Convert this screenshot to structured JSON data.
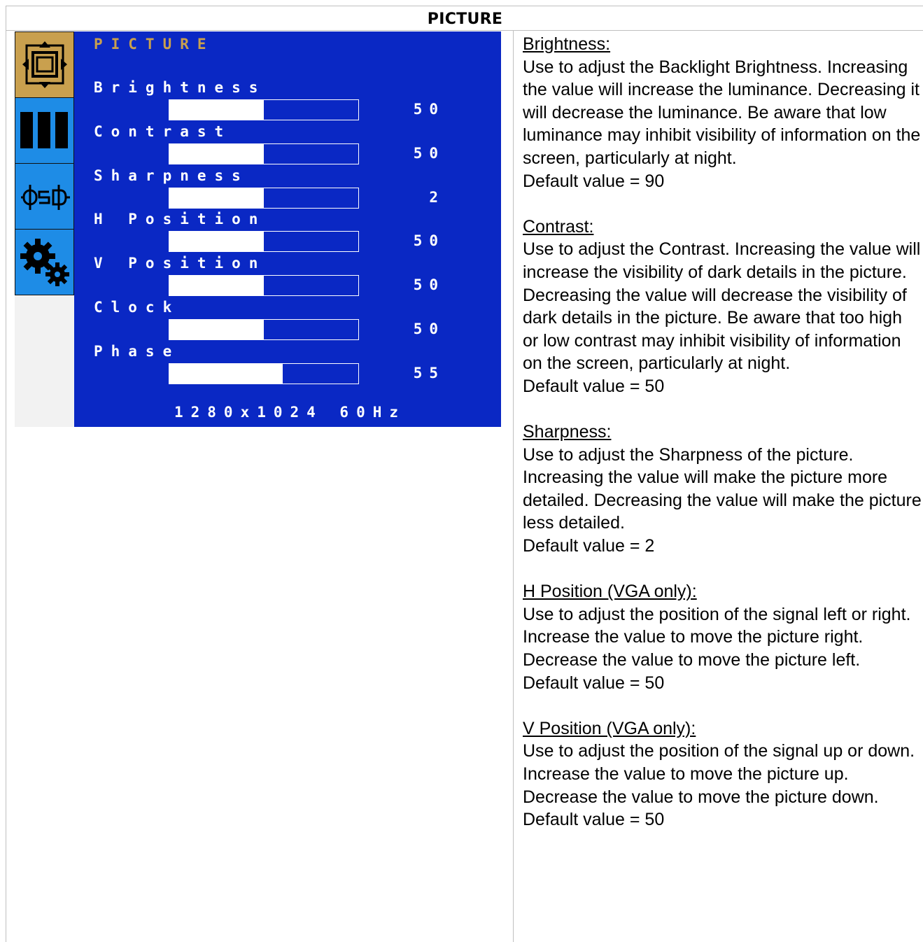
{
  "header": {
    "title": "PICTURE"
  },
  "osd": {
    "title": "PICTURE",
    "sidebar": [
      {
        "icon": "picture-frame-icon",
        "active": true
      },
      {
        "icon": "color-bars-icon",
        "active": false
      },
      {
        "icon": "osd-icon",
        "active": false
      },
      {
        "icon": "gears-icon",
        "active": false
      }
    ],
    "items": [
      {
        "label": "Brightness",
        "value": "50",
        "level": 0.5
      },
      {
        "label": "Contrast",
        "value": "50",
        "level": 0.5
      },
      {
        "label": "Sharpness",
        "value": "2",
        "level": 0.5
      },
      {
        "label": "H Position",
        "value": "50",
        "level": 0.5
      },
      {
        "label": "V Position",
        "value": "50",
        "level": 0.5
      },
      {
        "label": "Clock",
        "value": "50",
        "level": 0.5
      },
      {
        "label": "Phase",
        "value": "55",
        "level": 0.6
      }
    ],
    "resolution": "1280x1024  60Hz",
    "colors": {
      "panel": "#0a28c4",
      "title": "#c9a04e",
      "active_tab": "#c9a04e",
      "inactive_tab": "#1e8ce6"
    }
  },
  "descriptions": [
    {
      "heading": "Brightness:",
      "body": "Use to adjust the Backlight Brightness. Increasing the value will increase the luminance. Decreasing it will decrease the luminance. Be aware that low luminance may inhibit visibility of information on the screen, particularly at night.",
      "default": "Default value = 90"
    },
    {
      "heading": "Contrast:",
      "body": "Use to adjust the Contrast. Increasing the value will increase the visibility of dark details in the picture. Decreasing the value will decrease the visibility of dark details in the picture. Be aware that too high or low contrast may inhibit visibility of information on the screen, particularly at night.",
      "default": "Default value = 50"
    },
    {
      "heading": "Sharpness:",
      "body": "Use to adjust the Sharpness of the picture. Increasing the value will make the picture more detailed. Decreasing the value will make the picture less detailed.",
      "default": "Default value = 2"
    },
    {
      "heading": "H Position (VGA only):",
      "body": "Use to adjust the position of the signal left or right. Increase the value to move the picture right. Decrease the value to move the picture left.",
      "default": "Default value = 50"
    },
    {
      "heading": "V Position (VGA only):",
      "body": "Use to adjust the position of the signal up or down. Increase the value to move the picture up. Decrease the value to move the picture down.",
      "default": "Default value = 50"
    }
  ]
}
